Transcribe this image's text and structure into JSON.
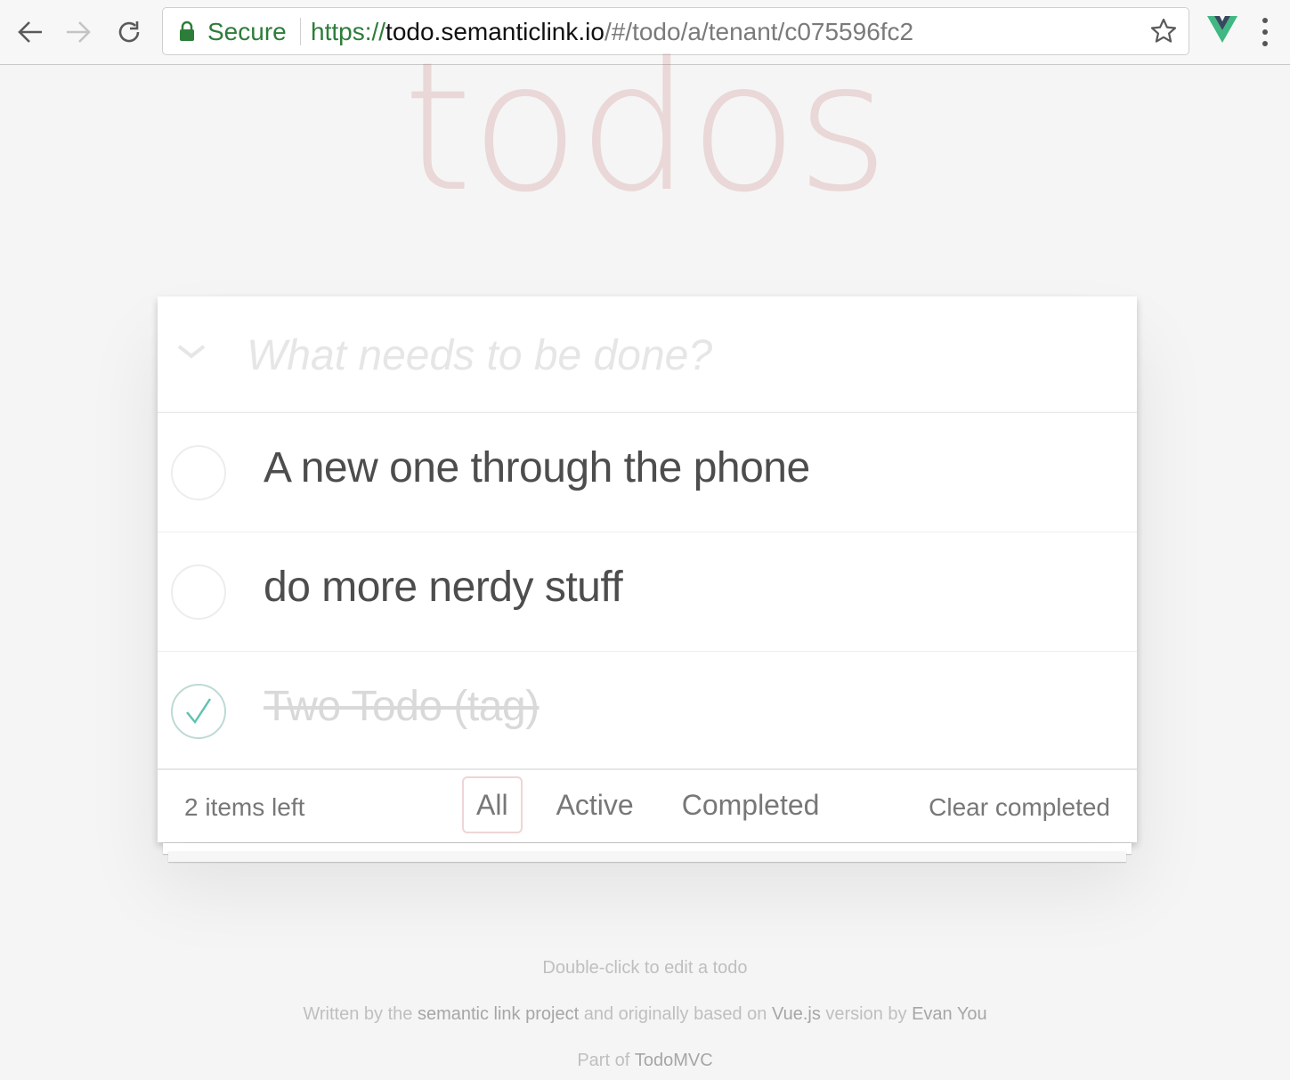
{
  "browser": {
    "secure_label": "Secure",
    "url_scheme": "https://",
    "url_host": "todo.semanticlink.io",
    "url_path": "/#/todo/a/tenant/c075596fc2",
    "icons": [
      "back-arrow-icon",
      "forward-arrow-icon",
      "reload-icon",
      "lock-icon",
      "star-icon",
      "vue-devtools-icon",
      "menu-dots-icon"
    ]
  },
  "app": {
    "title": "todos",
    "new_todo_placeholder": "What needs to be done?",
    "new_todo_value": "",
    "todos": [
      {
        "title": "A new one through the phone",
        "completed": false
      },
      {
        "title": "do more nerdy stuff",
        "completed": false
      },
      {
        "title": "Two Todo (tag)",
        "completed": true
      }
    ],
    "footer": {
      "count_text": "2 items left",
      "filters": [
        {
          "label": "All",
          "selected": true
        },
        {
          "label": "Active",
          "selected": false
        },
        {
          "label": "Completed",
          "selected": false
        }
      ],
      "clear_completed_label": "Clear completed"
    }
  },
  "info": {
    "edit_hint": "Double-click to edit a todo",
    "written_by_prefix": "Written by the ",
    "project_link": "semantic link project",
    "based_on_text": " and originally based on ",
    "vue_link": "Vue.js",
    "version_by_text": " version by ",
    "author_link": "Evan You",
    "part_of_prefix": "Part of ",
    "todomvc_link": "TodoMVC"
  },
  "colors": {
    "title": "#efdada",
    "secure_green": "#2d7d3a",
    "check_green": "#5dc2af",
    "filter_border": "#efd5d5"
  }
}
